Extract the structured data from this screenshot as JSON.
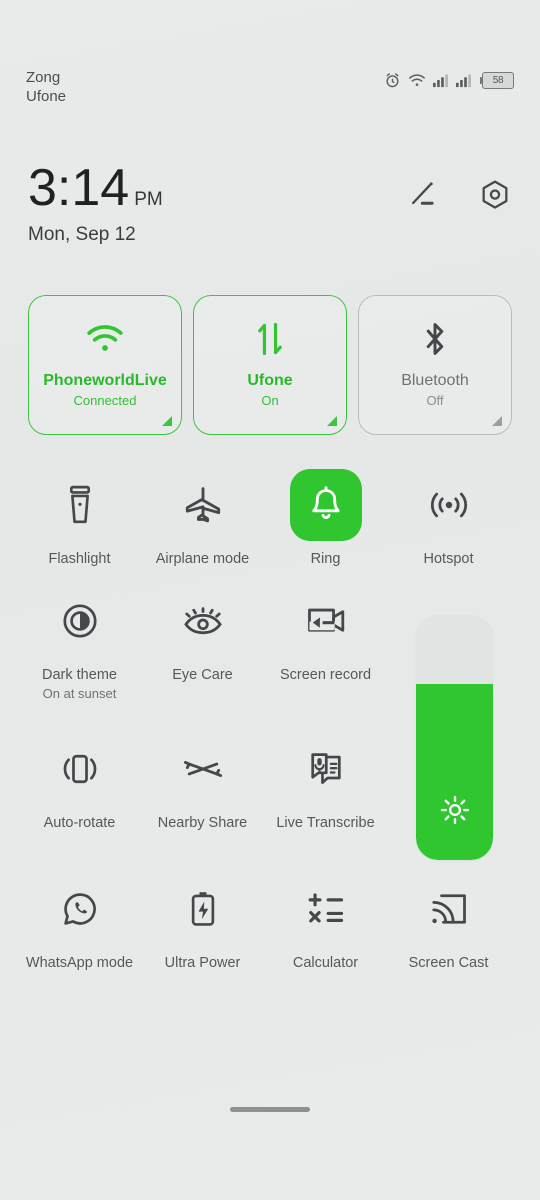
{
  "statusbar": {
    "carrier_primary": "Zong",
    "carrier_secondary": "Ufone",
    "battery_percent": "58",
    "icons": [
      "alarm-icon",
      "wifi-icon",
      "signal-icon-1",
      "signal-icon-2",
      "battery-icon"
    ]
  },
  "clock": {
    "time": "3:14",
    "ampm": "PM",
    "date": "Mon, Sep 12",
    "edit_icon": "edit-pencil-icon",
    "settings_icon": "settings-hexagon-icon"
  },
  "big_tiles": [
    {
      "name": "PhoneworldLive",
      "status": "Connected",
      "state": "on",
      "icon": "wifi-icon"
    },
    {
      "name": "Ufone",
      "status": "On",
      "state": "on",
      "icon": "mobile-data-icon"
    },
    {
      "name": "Bluetooth",
      "status": "Off",
      "state": "off",
      "icon": "bluetooth-icon"
    }
  ],
  "toggles": [
    {
      "label": "Flashlight",
      "sub": "",
      "icon": "flashlight-icon",
      "state": "off"
    },
    {
      "label": "Airplane mode",
      "sub": "",
      "icon": "airplane-icon",
      "state": "off"
    },
    {
      "label": "Ring",
      "sub": "",
      "icon": "bell-icon",
      "state": "on"
    },
    {
      "label": "Hotspot",
      "sub": "",
      "icon": "hotspot-icon",
      "state": "off"
    },
    {
      "label": "Dark theme",
      "sub": "On at sunset",
      "icon": "contrast-circle-icon",
      "state": "off"
    },
    {
      "label": "Eye Care",
      "sub": "",
      "icon": "eye-icon",
      "state": "off"
    },
    {
      "label": "Screen record",
      "sub": "",
      "icon": "screen-record-icon",
      "state": "off"
    },
    {
      "label": "Auto-rotate",
      "sub": "",
      "icon": "auto-rotate-icon",
      "state": "off"
    },
    {
      "label": "Nearby Share",
      "sub": "",
      "icon": "nearby-share-icon",
      "state": "off"
    },
    {
      "label": "Live Transcribe",
      "sub": "",
      "icon": "live-transcribe-icon",
      "state": "off"
    },
    {
      "label": "WhatsApp mode",
      "sub": "",
      "icon": "whatsapp-icon",
      "state": "off"
    },
    {
      "label": "Ultra Power",
      "sub": "",
      "icon": "battery-bolt-icon",
      "state": "off"
    },
    {
      "label": "Calculator",
      "sub": "",
      "icon": "calculator-icon",
      "state": "off"
    },
    {
      "label": "Screen Cast",
      "sub": "",
      "icon": "screen-cast-icon",
      "state": "off"
    }
  ],
  "brightness": {
    "level_percent": 72,
    "icon": "brightness-sun-icon"
  },
  "colors": {
    "accent_green": "#2fc62f",
    "tile_on_text": "#2cb82c",
    "inactive_text": "#55585a",
    "background": "#e8eaea"
  },
  "home_indicator": "home-gesture-bar"
}
